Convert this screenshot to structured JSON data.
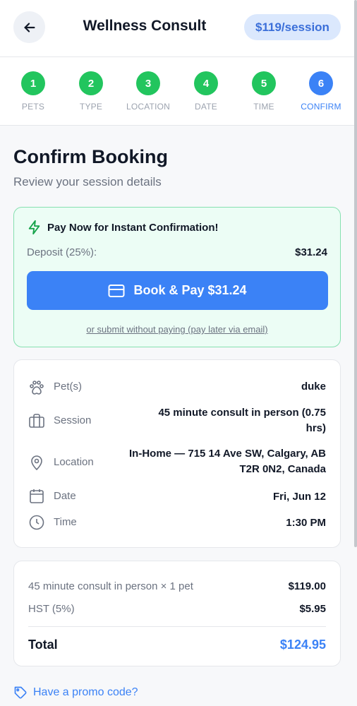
{
  "header": {
    "title": "Wellness Consult",
    "price": "$119/session"
  },
  "steps": [
    {
      "number": "1",
      "label": "PETS"
    },
    {
      "number": "2",
      "label": "TYPE"
    },
    {
      "number": "3",
      "label": "LOCATION"
    },
    {
      "number": "4",
      "label": "DATE"
    },
    {
      "number": "5",
      "label": "TIME"
    },
    {
      "number": "6",
      "label": "CONFIRM"
    }
  ],
  "page": {
    "heading": "Confirm Booking",
    "subtitle": "Review your session details"
  },
  "pay": {
    "headline": "Pay Now for Instant Confirmation!",
    "deposit_label": "Deposit (25%):",
    "deposit_value": "$31.24",
    "button_label": "Book & Pay $31.24",
    "pay_later": "or submit without paying (pay later via email)"
  },
  "details": {
    "pets_label": "Pet(s)",
    "pets_value": "duke",
    "session_label": "Session",
    "session_value": "45 minute consult in person (0.75 hrs)",
    "location_label": "Location",
    "location_value": "In-Home — 715 14 Ave SW, Calgary, AB T2R 0N2, Canada",
    "date_label": "Date",
    "date_value": "Fri, Jun 12",
    "time_label": "Time",
    "time_value": "1:30 PM"
  },
  "totals": {
    "line_label": "45 minute consult in person × 1 pet",
    "line_value": "$119.00",
    "tax_label": "HST (5%)",
    "tax_value": "$5.95",
    "total_label": "Total",
    "total_value": "$124.95"
  },
  "promo": {
    "label": "Have a promo code?"
  },
  "colors": {
    "accent": "#3b82f6",
    "success": "#22c55e",
    "pay_card_bg": "#ecfdf5"
  },
  "icons": {
    "back": "arrow-left-icon",
    "zap": "lightning-icon",
    "card": "credit-card-icon",
    "pets": "paw-icon",
    "session": "briefcase-icon",
    "location": "map-pin-icon",
    "date": "calendar-icon",
    "time": "clock-icon",
    "promo": "tag-icon"
  }
}
